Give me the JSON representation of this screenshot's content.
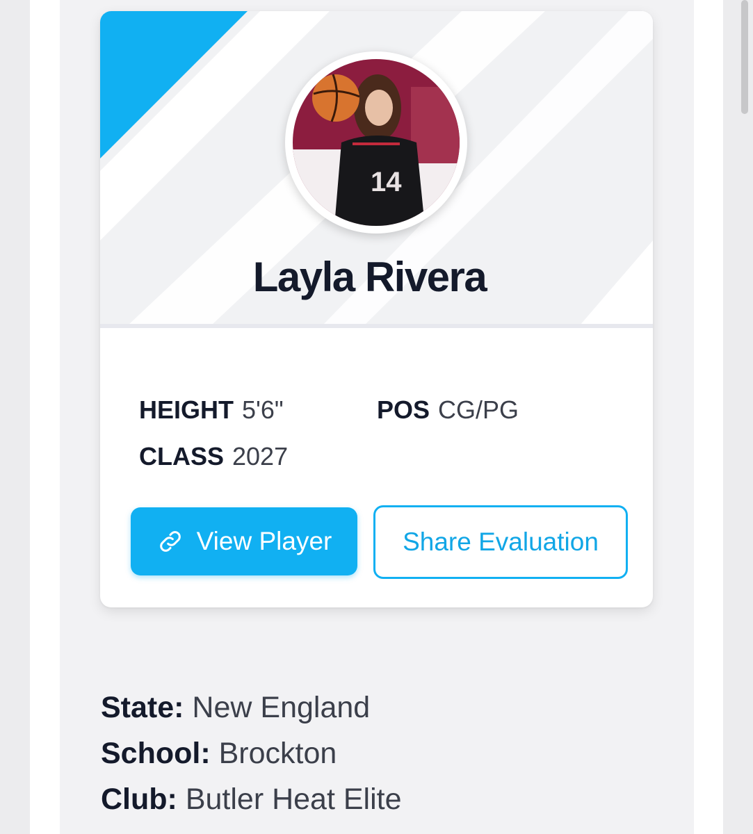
{
  "player": {
    "name": "Layla Rivera",
    "photo_alt": "Player photo"
  },
  "stats": {
    "height_label": "HEIGHT",
    "height_value": "5'6\"",
    "position_label": "POS",
    "position_value": "CG/PG",
    "class_label": "CLASS",
    "class_value": "2027"
  },
  "actions": {
    "view_player_label": "View Player",
    "view_player_icon": "link-icon",
    "share_label": "Share Evaluation"
  },
  "details": {
    "state_label": "State:",
    "state_value": "New England",
    "school_label": "School:",
    "school_value": "Brockton",
    "club_label": "Club:",
    "club_value": "Butler Heat Elite"
  },
  "colors": {
    "accent": "#11b0f2",
    "text_dark": "#141a2b",
    "text_muted": "#3b3f4a",
    "photo_backdrop": "#8c1d3f"
  }
}
